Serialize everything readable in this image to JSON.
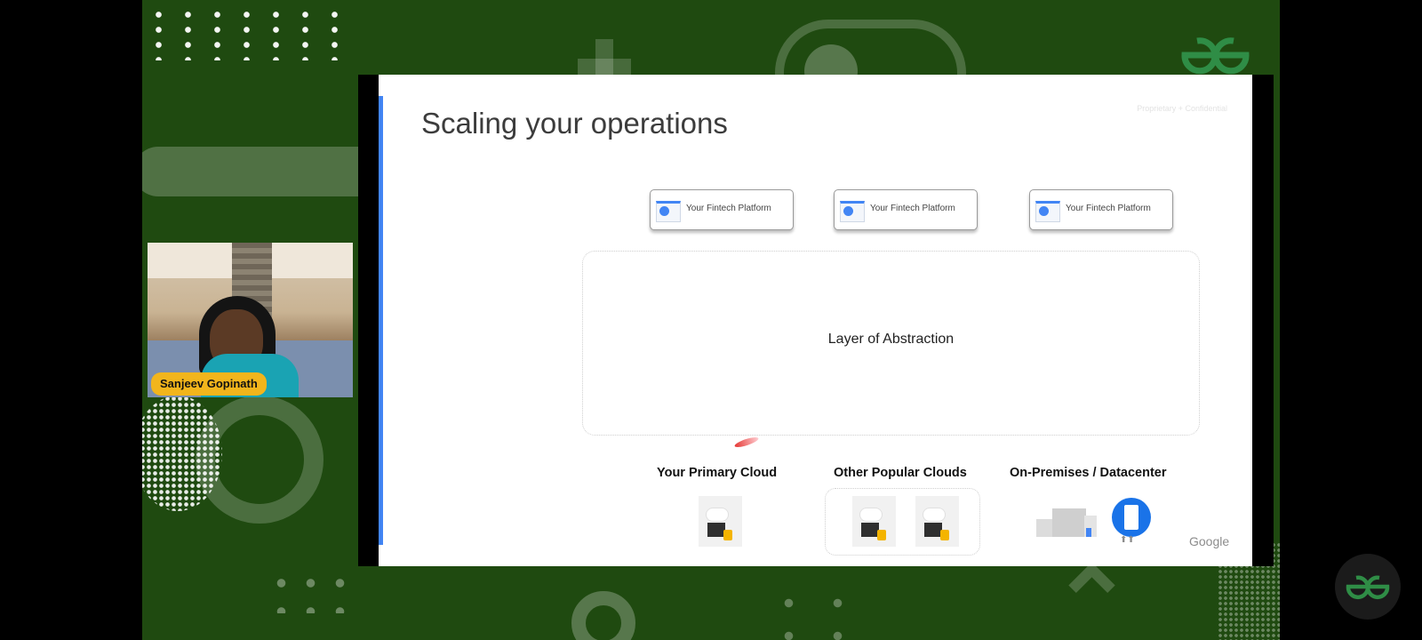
{
  "presenter": {
    "name": "Sanjeev Gopinath"
  },
  "slide": {
    "title": "Scaling your operations",
    "confidential": "Proprietary + Confidential",
    "platforms": [
      "Your Fintech Platform",
      "Your Fintech Platform",
      "Your Fintech Platform"
    ],
    "abstraction_label": "Layer of Abstraction",
    "targets": [
      "Your Primary Cloud",
      "Other Popular Clouds",
      "On-Premises / Datacenter"
    ],
    "brand": "Google"
  },
  "colors": {
    "background_green": "#1f4a10",
    "accent_blue": "#4285f4",
    "gfg_green": "#2f8d46",
    "name_tag": "#f2b51c"
  },
  "icons": [
    "gfg-logo-icon",
    "cloud-server-icon",
    "datacenter-icon",
    "server-icon",
    "browser-window-icon"
  ]
}
